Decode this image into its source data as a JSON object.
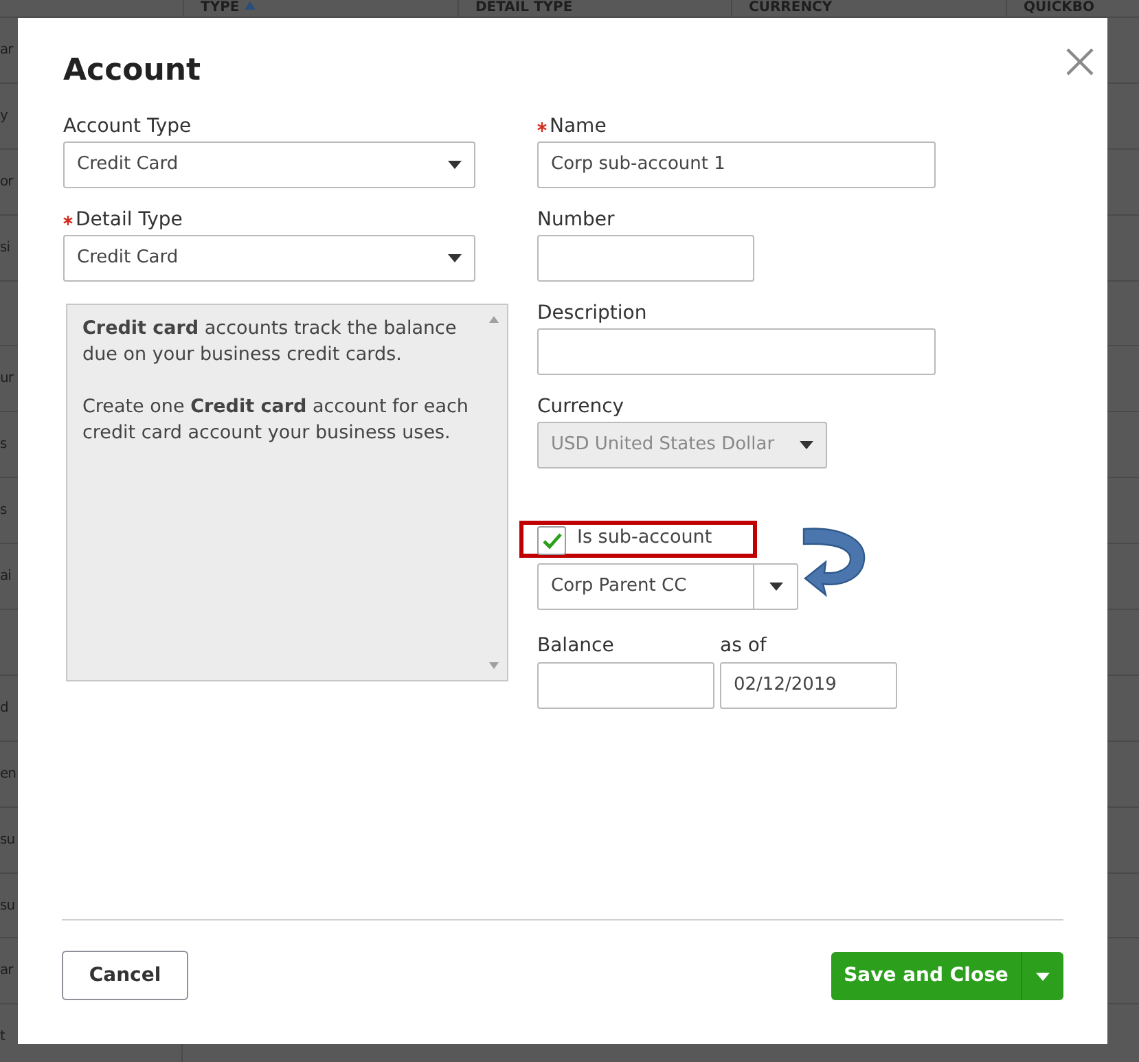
{
  "background_table": {
    "columns": [
      "TYPE",
      "DETAIL TYPE",
      "CURRENCY",
      "QUICKBO"
    ],
    "rows": [
      {
        "kind": "text",
        "column_1": "ar"
      },
      {
        "kind": "text",
        "column_1": "y"
      },
      {
        "kind": "text",
        "column_1": "or"
      },
      {
        "kind": "text",
        "column_1": "si"
      },
      {
        "kind": "blank"
      },
      {
        "kind": "text",
        "column_1": "ur"
      },
      {
        "kind": "text",
        "column_1": "s"
      },
      {
        "kind": "text",
        "column_1": "s"
      },
      {
        "kind": "text",
        "column_1": "ai"
      },
      {
        "kind": "blank"
      },
      {
        "kind": "text",
        "column_1": "d"
      },
      {
        "kind": "text",
        "column_1": "en"
      },
      {
        "kind": "text",
        "column_1": "su"
      },
      {
        "kind": "text",
        "column_1": "su"
      },
      {
        "kind": "text",
        "column_1": "ar"
      },
      {
        "kind": "text",
        "column_1": "t"
      }
    ]
  },
  "dialog": {
    "title": "Account",
    "account_type": {
      "label": "Account Type",
      "required": false,
      "value": "Credit Card"
    },
    "detail_type": {
      "label": "Detail Type",
      "required": true,
      "value": "Credit Card"
    },
    "help_paragraphs": [
      "**Credit card** accounts track the balance due on your business credit cards.",
      "Create one **Credit card** account for each credit card account your business uses."
    ],
    "name": {
      "label": "Name",
      "required": true,
      "value": "Corp sub-account 1"
    },
    "number": {
      "label": "Number"
    },
    "description": {
      "label": "Description"
    },
    "currency": {
      "label": "Currency",
      "value": "USD United States Dollar",
      "disabled": true
    },
    "sub_account": {
      "label": "Is sub-account",
      "checked": true,
      "highlighted": true
    },
    "parent_account": {
      "value": "Corp Parent CC"
    },
    "balance": {
      "label": "Balance"
    },
    "as_of": {
      "label": "as of",
      "value": "02/12/2019"
    },
    "cancel_button": "Cancel",
    "save_button": "Save and Close"
  }
}
